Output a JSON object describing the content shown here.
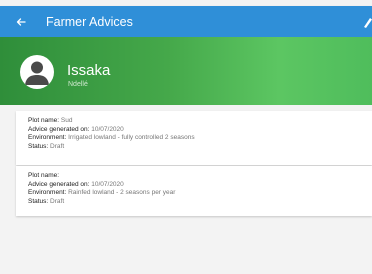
{
  "appbar": {
    "title": "Farmer Advices",
    "back_icon": "arrow-left-icon",
    "action_icon": "edit-icon",
    "color": "#2f8fd8"
  },
  "profile": {
    "name": "Issaka",
    "location": "Ndellé",
    "avatar_icon": "person-icon",
    "banner_color": "#45a84a"
  },
  "advices": [
    {
      "plot_label": "Plot name:",
      "plot_value": "Sud",
      "date_label": "Advice generated on:",
      "date_value": "10/07/2020",
      "env_label": "Environment:",
      "env_value": "Irrigated lowland - fully controlled 2 seasons",
      "status_label": "Status:",
      "status_value": "Draft"
    },
    {
      "plot_label": "Plot name:",
      "plot_value": "",
      "date_label": "Advice generated on:",
      "date_value": "10/07/2020",
      "env_label": "Environment:",
      "env_value": "Rainfed lowland - 2 seasons per year",
      "status_label": "Status:",
      "status_value": "Draft"
    }
  ]
}
